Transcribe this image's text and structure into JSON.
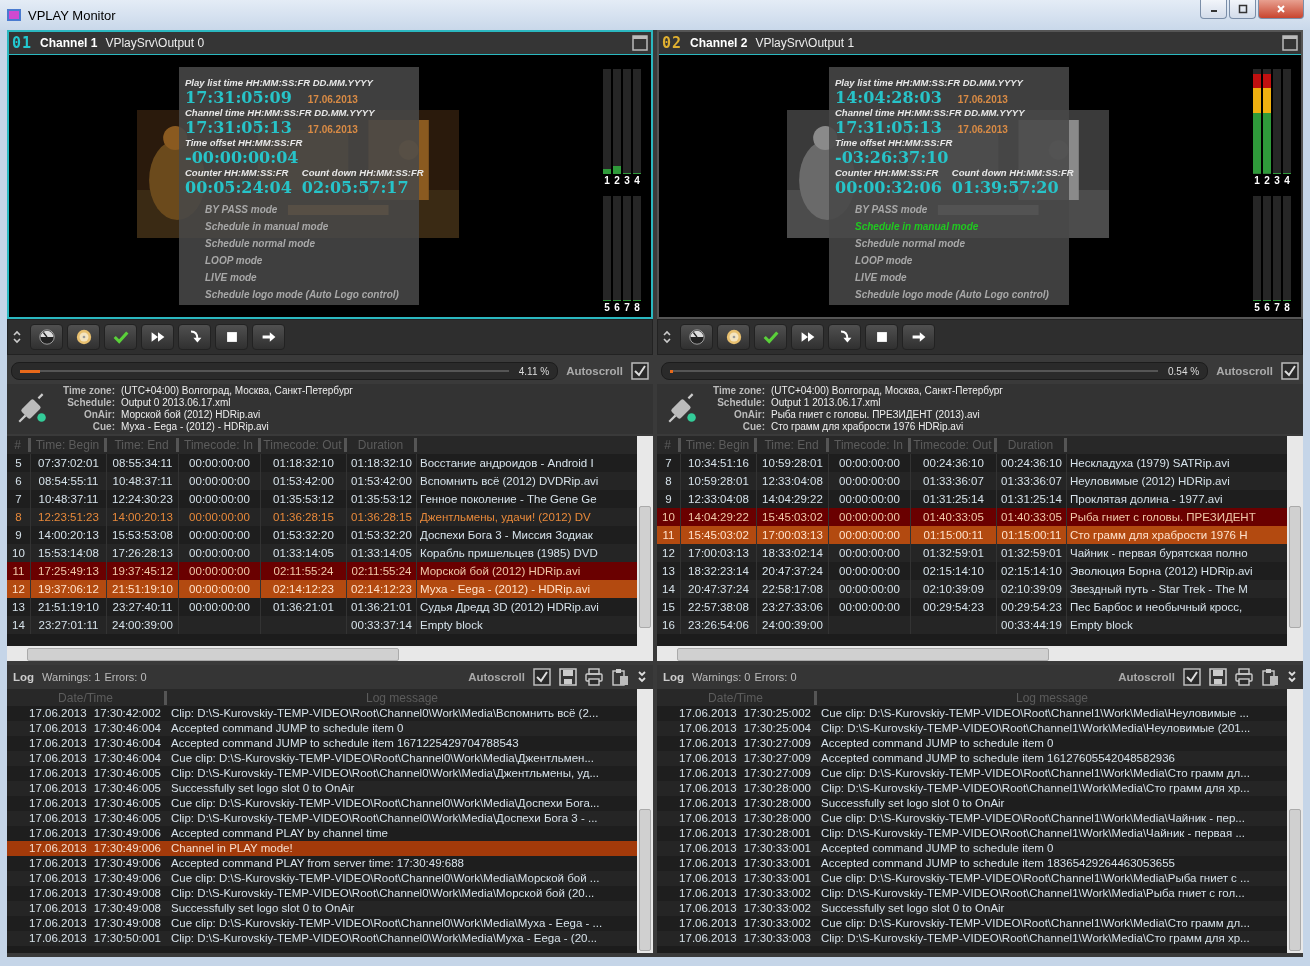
{
  "window": {
    "title": "VPLAY Monitor"
  },
  "channels": [
    {
      "number": "01",
      "color": "#22c8d0",
      "name": "Channel 1",
      "source": "VPlaySrv\\Output 0",
      "selected": true,
      "overlay": {
        "playlist_label": "Play list time HH:MM:SS:FR  DD.MM.YYYY",
        "playlist_time": "17:31:05:09",
        "playlist_date": "17.06.2013",
        "channel_label": "Channel time HH:MM:SS:FR  DD.MM.YYYY",
        "channel_time": "17:31:05:13",
        "channel_date": "17.06.2013",
        "offset_label": "Time offset HH:MM:SS:FR",
        "offset": "-00:00:00:04",
        "counter_label": "Counter HH:MM:SS:FR",
        "counter": "00:05:24:04",
        "countdown_label": "Count down HH:MM:SS:FR",
        "countdown": "02:05:57:17",
        "modes": [
          {
            "label": "BY PASS mode",
            "selected": false
          },
          {
            "label": "Schedule in manual mode",
            "selected": false
          },
          {
            "label": "Schedule normal mode",
            "selected": false
          },
          {
            "label": "LOOP mode",
            "selected": false
          },
          {
            "label": "LIVE mode",
            "selected": false
          },
          {
            "label": "Schedule logo mode (Auto Logo control)",
            "selected": false
          }
        ]
      },
      "meters": [
        {
          "label": "1",
          "level": 0.05
        },
        {
          "label": "2",
          "level": 0.08
        },
        {
          "label": "3",
          "level": 0.0
        },
        {
          "label": "4",
          "level": 0.0
        },
        {
          "label": "5",
          "level": 0.0
        },
        {
          "label": "6",
          "level": 0.0
        },
        {
          "label": "7",
          "level": 0.0
        },
        {
          "label": "8",
          "level": 0.0
        }
      ],
      "progress": {
        "level": 0.0411,
        "reading": "4.11 %"
      },
      "autoscroll": {
        "label": "Autoscroll",
        "checked": true
      },
      "info": [
        {
          "label": "Time zone:",
          "value": "(UTC+04:00) Волгоград, Москва, Санкт-Петербург"
        },
        {
          "label": "Schedule:",
          "value": "Output 0 2013.06.17.xml"
        },
        {
          "label": "OnAir:",
          "value": "Морской бой (2012) HDRip.avi"
        },
        {
          "label": "Cue:",
          "value": "Муха - Eega - (2012) - HDRip.avi"
        }
      ],
      "schedule": {
        "columns": [
          "#",
          "Time: Begin",
          "Time: End",
          "Timecode: In",
          "Timecode: Out",
          "Duration"
        ],
        "rows": [
          {
            "number": "5",
            "begin": "07:37:02:01",
            "end": "08:55:34:11",
            "tc_in": "00:00:00:00",
            "tc_out": "01:18:32:10",
            "duration": "01:18:32:10",
            "name": "Восстание андроидов - Android I",
            "kind": "normal"
          },
          {
            "number": "6",
            "begin": "08:54:55:11",
            "end": "10:48:37:11",
            "tc_in": "00:00:00:00",
            "tc_out": "01:53:42:00",
            "duration": "01:53:42:00",
            "name": "Вспомнить всё (2012) DVDRip.avi",
            "kind": "normal"
          },
          {
            "number": "7",
            "begin": "10:48:37:11",
            "end": "12:24:30:23",
            "tc_in": "00:00:00:00",
            "tc_out": "01:35:53:12",
            "duration": "01:35:53:12",
            "name": "Генное поколение - The Gene Ge",
            "kind": "normal"
          },
          {
            "number": "8",
            "begin": "12:23:51:23",
            "end": "14:00:20:13",
            "tc_in": "00:00:00:00",
            "tc_out": "01:36:28:15",
            "duration": "01:36:28:15",
            "name": "Джентльмены, удачи! (2012) DV",
            "kind": "marked"
          },
          {
            "number": "9",
            "begin": "14:00:20:13",
            "end": "15:53:53:08",
            "tc_in": "00:00:00:00",
            "tc_out": "01:53:32:20",
            "duration": "01:53:32:20",
            "name": "Доспехи Бога 3 - Миссия Зодиак",
            "kind": "normal"
          },
          {
            "number": "10",
            "begin": "15:53:14:08",
            "end": "17:26:28:13",
            "tc_in": "00:00:00:00",
            "tc_out": "01:33:14:05",
            "duration": "01:33:14:05",
            "name": "Корабль пришельцев (1985) DVD",
            "kind": "normal"
          },
          {
            "number": "11",
            "begin": "17:25:49:13",
            "end": "19:37:45:12",
            "tc_in": "00:00:00:00",
            "tc_out": "02:11:55:24",
            "duration": "02:11:55:24",
            "name": "Морской бой (2012) HDRip.avi",
            "kind": "onair"
          },
          {
            "number": "12",
            "begin": "19:37:06:12",
            "end": "21:51:19:10",
            "tc_in": "00:00:00:00",
            "tc_out": "02:14:12:23",
            "duration": "02:14:12:23",
            "name": "Муха - Eega - (2012) - HDRip.avi",
            "kind": "cue"
          },
          {
            "number": "13",
            "begin": "21:51:19:10",
            "end": "23:27:40:11",
            "tc_in": "00:00:00:00",
            "tc_out": "01:36:21:01",
            "duration": "01:36:21:01",
            "name": "Судья Дредд 3D (2012) HDRip.avi",
            "kind": "normal"
          },
          {
            "number": "14",
            "begin": "23:27:01:11",
            "end": "24:00:39:00",
            "duration": "00:33:37:14",
            "name": "Empty block",
            "kind": "normal"
          }
        ]
      },
      "log": {
        "title": "Log",
        "warnings": "Warnings: 1",
        "errors": "Errors: 0",
        "autoscroll": {
          "label": "Autoscroll",
          "checked": true
        },
        "columns": [
          "Date/Time",
          "Log message"
        ],
        "rows": [
          {
            "datetime": "17.06.2013 17:30:42:002",
            "message": "Clip: D:\\S-Kurovskiy-TEMP-VIDEO\\Root\\Channel0\\Work\\Media\\Вспомнить всё (2...",
            "highlighted": false
          },
          {
            "datetime": "17.06.2013 17:30:46:004",
            "message": "Accepted command JUMP to schedule item 0",
            "highlighted": false
          },
          {
            "datetime": "17.06.2013 17:30:46:004",
            "message": "Accepted command JUMP to schedule item 1671225429704788543",
            "highlighted": false
          },
          {
            "datetime": "17.06.2013 17:30:46:004",
            "message": "Cue clip: D:\\S-Kurovskiy-TEMP-VIDEO\\Root\\Channel0\\Work\\Media\\Джентльмен...",
            "highlighted": false
          },
          {
            "datetime": "17.06.2013 17:30:46:005",
            "message": "Clip: D:\\S-Kurovskiy-TEMP-VIDEO\\Root\\Channel0\\Work\\Media\\Джентльмены, уд...",
            "highlighted": false
          },
          {
            "datetime": "17.06.2013 17:30:46:005",
            "message": "Successfully set logo slot 0 to OnAir",
            "highlighted": false
          },
          {
            "datetime": "17.06.2013 17:30:46:005",
            "message": "Cue clip: D:\\S-Kurovskiy-TEMP-VIDEO\\Root\\Channel0\\Work\\Media\\Доспехи Бога...",
            "highlighted": false
          },
          {
            "datetime": "17.06.2013 17:30:46:005",
            "message": "Clip: D:\\S-Kurovskiy-TEMP-VIDEO\\Root\\Channel0\\Work\\Media\\Доспехи Бога 3 - ...",
            "highlighted": false
          },
          {
            "datetime": "17.06.2013 17:30:49:006",
            "message": "Accepted command PLAY by channel time",
            "highlighted": false
          },
          {
            "datetime": "17.06.2013 17:30:49:006",
            "message": "Channel in PLAY mode!",
            "highlighted": true
          },
          {
            "datetime": "17.06.2013 17:30:49:006",
            "message": "Accepted command PLAY from server time: 17:30:49:688",
            "highlighted": false
          },
          {
            "datetime": "17.06.2013 17:30:49:006",
            "message": "Cue clip: D:\\S-Kurovskiy-TEMP-VIDEO\\Root\\Channel0\\Work\\Media\\Морской бой ...",
            "highlighted": false
          },
          {
            "datetime": "17.06.2013 17:30:49:008",
            "message": "Clip: D:\\S-Kurovskiy-TEMP-VIDEO\\Root\\Channel0\\Work\\Media\\Морской бой (20...",
            "highlighted": false
          },
          {
            "datetime": "17.06.2013 17:30:49:008",
            "message": "Successfully set logo slot 0 to OnAir",
            "highlighted": false
          },
          {
            "datetime": "17.06.2013 17:30:49:008",
            "message": "Cue clip: D:\\S-Kurovskiy-TEMP-VIDEO\\Root\\Channel0\\Work\\Media\\Муха - Eega - ...",
            "highlighted": false
          },
          {
            "datetime": "17.06.2013 17:30:50:001",
            "message": "Clip: D:\\S-Kurovskiy-TEMP-VIDEO\\Root\\Channel0\\Work\\Media\\Муха - Eega - (20...",
            "highlighted": false
          }
        ]
      }
    },
    {
      "number": "02",
      "color": "#e0b030",
      "name": "Channel 2",
      "source": "VPlaySrv\\Output 1",
      "selected": false,
      "overlay": {
        "playlist_label": "Play list time HH:MM:SS:FR  DD.MM.YYYY",
        "playlist_time": "14:04:28:03",
        "playlist_date": "17.06.2013",
        "channel_label": "Channel time HH:MM:SS:FR  DD.MM.YYYY",
        "channel_time": "17:31:05:13",
        "channel_date": "17.06.2013",
        "offset_label": "Time offset HH:MM:SS:FR",
        "offset": "-03:26:37:10",
        "counter_label": "Counter HH:MM:SS:FR",
        "counter": "00:00:32:06",
        "countdown_label": "Count down HH:MM:SS:FR",
        "countdown": "01:39:57:20",
        "modes": [
          {
            "label": "BY PASS mode",
            "selected": false
          },
          {
            "label": "Schedule in manual mode",
            "selected": true
          },
          {
            "label": "Schedule normal mode",
            "selected": false
          },
          {
            "label": "LOOP mode",
            "selected": false
          },
          {
            "label": "LIVE mode",
            "selected": false
          },
          {
            "label": "Schedule logo mode (Auto Logo control)",
            "selected": false
          }
        ]
      },
      "meters": [
        {
          "label": "1",
          "level": 0.95
        },
        {
          "label": "2",
          "level": 0.95
        },
        {
          "label": "3",
          "level": 0.0
        },
        {
          "label": "4",
          "level": 0.0
        },
        {
          "label": "5",
          "level": 0.0
        },
        {
          "label": "6",
          "level": 0.0
        },
        {
          "label": "7",
          "level": 0.0
        },
        {
          "label": "8",
          "level": 0.0
        }
      ],
      "progress": {
        "level": 0.0054,
        "reading": "0.54 %"
      },
      "autoscroll": {
        "label": "Autoscroll",
        "checked": true
      },
      "info": [
        {
          "label": "Time zone:",
          "value": "(UTC+04:00) Волгоград, Москва, Санкт-Петербург"
        },
        {
          "label": "Schedule:",
          "value": "Output 1 2013.06.17.xml"
        },
        {
          "label": "OnAir:",
          "value": "Рыба гниет с головы. ПРЕЗИДЕНТ (2013).avi"
        },
        {
          "label": "Cue:",
          "value": "Сто грамм для храбрости 1976 HDRip.avi"
        }
      ],
      "schedule": {
        "columns": [
          "#",
          "Time: Begin",
          "Time: End",
          "Timecode: In",
          "Timecode: Out",
          "Duration"
        ],
        "rows": [
          {
            "number": "7",
            "begin": "10:34:51:16",
            "end": "10:59:28:01",
            "tc_in": "00:00:00:00",
            "tc_out": "00:24:36:10",
            "duration": "00:24:36:10",
            "name": "Нескладуха (1979) SATRip.avi",
            "kind": "normal"
          },
          {
            "number": "8",
            "begin": "10:59:28:01",
            "end": "12:33:04:08",
            "tc_in": "00:00:00:00",
            "tc_out": "01:33:36:07",
            "duration": "01:33:36:07",
            "name": "Неуловимые (2012) HDRip.avi",
            "kind": "normal"
          },
          {
            "number": "9",
            "begin": "12:33:04:08",
            "end": "14:04:29:22",
            "tc_in": "00:00:00:00",
            "tc_out": "01:31:25:14",
            "duration": "01:31:25:14",
            "name": "Проклятая долина - 1977.avi",
            "kind": "normal"
          },
          {
            "number": "10",
            "begin": "14:04:29:22",
            "end": "15:45:03:02",
            "tc_in": "00:00:00:00",
            "tc_out": "01:40:33:05",
            "duration": "01:40:33:05",
            "name": "Рыба гниет с головы. ПРЕЗИДЕНТ",
            "kind": "onair"
          },
          {
            "number": "11",
            "begin": "15:45:03:02",
            "end": "17:00:03:13",
            "tc_in": "00:00:00:00",
            "tc_out": "01:15:00:11",
            "duration": "01:15:00:11",
            "name": "Сто грамм для храбрости 1976 H",
            "kind": "cue"
          },
          {
            "number": "12",
            "begin": "17:00:03:13",
            "end": "18:33:02:14",
            "tc_in": "00:00:00:00",
            "tc_out": "01:32:59:01",
            "duration": "01:32:59:01",
            "name": "Чайник - первая бурятская полно",
            "kind": "normal"
          },
          {
            "number": "13",
            "begin": "18:32:23:14",
            "end": "20:47:37:24",
            "tc_in": "00:00:00:00",
            "tc_out": "02:15:14:10",
            "duration": "02:15:14:10",
            "name": "Эволюция Борна (2012) HDRip.avi",
            "kind": "normal"
          },
          {
            "number": "14",
            "begin": "20:47:37:24",
            "end": "22:58:17:08",
            "tc_in": "00:00:00:00",
            "tc_out": "02:10:39:09",
            "duration": "02:10:39:09",
            "name": "Звездный путь - Star Trek - The M",
            "kind": "normal"
          },
          {
            "number": "15",
            "begin": "22:57:38:08",
            "end": "23:27:33:06",
            "tc_in": "00:00:00:00",
            "tc_out": "00:29:54:23",
            "duration": "00:29:54:23",
            "name": "Пес Барбос и необычный кросс,",
            "kind": "normal"
          },
          {
            "number": "16",
            "begin": "23:26:54:06",
            "end": "24:00:39:00",
            "duration": "00:33:44:19",
            "name": "Empty block",
            "kind": "normal"
          }
        ]
      },
      "log": {
        "title": "Log",
        "warnings": "Warnings: 0",
        "errors": "Errors: 0",
        "autoscroll": {
          "label": "Autoscroll",
          "checked": true
        },
        "columns": [
          "Date/Time",
          "Log message"
        ],
        "rows": [
          {
            "datetime": "17.06.2013 17:30:25:002",
            "message": "Cue clip: D:\\S-Kurovskiy-TEMP-VIDEO\\Root\\Channel1\\Work\\Media\\Неуловимые ...",
            "highlighted": false
          },
          {
            "datetime": "17.06.2013 17:30:25:004",
            "message": "Clip: D:\\S-Kurovskiy-TEMP-VIDEO\\Root\\Channel1\\Work\\Media\\Неуловимые (201...",
            "highlighted": false
          },
          {
            "datetime": "17.06.2013 17:30:27:009",
            "message": "Accepted command JUMP to schedule item 0",
            "highlighted": false
          },
          {
            "datetime": "17.06.2013 17:30:27:009",
            "message": "Accepted command JUMP to schedule item 16127605542048582936",
            "highlighted": false
          },
          {
            "datetime": "17.06.2013 17:30:27:009",
            "message": "Cue clip: D:\\S-Kurovskiy-TEMP-VIDEO\\Root\\Channel1\\Work\\Media\\Сто грамм дл...",
            "highlighted": false
          },
          {
            "datetime": "17.06.2013 17:30:28:000",
            "message": "Clip: D:\\S-Kurovskiy-TEMP-VIDEO\\Root\\Channel1\\Work\\Media\\Сто грамм для хр...",
            "highlighted": false
          },
          {
            "datetime": "17.06.2013 17:30:28:000",
            "message": "Successfully set logo slot 0 to OnAir",
            "highlighted": false
          },
          {
            "datetime": "17.06.2013 17:30:28:000",
            "message": "Cue clip: D:\\S-Kurovskiy-TEMP-VIDEO\\Root\\Channel1\\Work\\Media\\Чайник - пер...",
            "highlighted": false
          },
          {
            "datetime": "17.06.2013 17:30:28:001",
            "message": "Clip: D:\\S-Kurovskiy-TEMP-VIDEO\\Root\\Channel1\\Work\\Media\\Чайник - первая ...",
            "highlighted": false
          },
          {
            "datetime": "17.06.2013 17:30:33:001",
            "message": "Accepted command JUMP to schedule item 0",
            "highlighted": false
          },
          {
            "datetime": "17.06.2013 17:30:33:001",
            "message": "Accepted command JUMP to schedule item 18365429264463053655",
            "highlighted": false
          },
          {
            "datetime": "17.06.2013 17:30:33:001",
            "message": "Cue clip: D:\\S-Kurovskiy-TEMP-VIDEO\\Root\\Channel1\\Work\\Media\\Рыба гниет с ...",
            "highlighted": false
          },
          {
            "datetime": "17.06.2013 17:30:33:002",
            "message": "Clip: D:\\S-Kurovskiy-TEMP-VIDEO\\Root\\Channel1\\Work\\Media\\Рыба гниет с гол...",
            "highlighted": false
          },
          {
            "datetime": "17.06.2013 17:30:33:002",
            "message": "Successfully set logo slot 0 to OnAir",
            "highlighted": false
          },
          {
            "datetime": "17.06.2013 17:30:33:002",
            "message": "Cue clip: D:\\S-Kurovskiy-TEMP-VIDEO\\Root\\Channel1\\Work\\Media\\Сто грамм дл...",
            "highlighted": false
          },
          {
            "datetime": "17.06.2013 17:30:33:003",
            "message": "Clip: D:\\S-Kurovskiy-TEMP-VIDEO\\Root\\Channel1\\Work\\Media\\Сто грамм для хр...",
            "highlighted": false
          }
        ]
      }
    }
  ]
}
